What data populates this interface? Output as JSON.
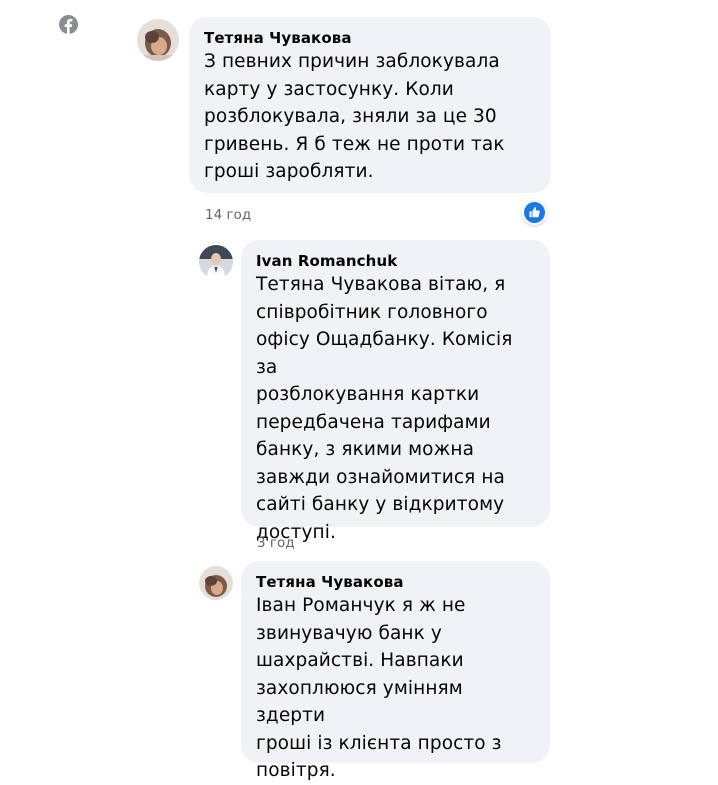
{
  "comments": [
    {
      "author": "Тетяна Чувакова",
      "text": "З певних причин заблокувала\nкарту у застосунку. Коли\nрозблокувала, зняли за це 30\nгривень. Я б теж не проти так\nгроші заробляти.",
      "time": "14 год"
    },
    {
      "author": "Ivan Romanchuk",
      "text": "Тетяна Чувакова вітаю, я\nспівробітник головного\nофісу Ощадбанку. Комісія за\nрозблокування картки\nпередбачена тарифами\nбанку, з якими можна\nзавжди ознайомитися на\nсайті банку у відкритому\nдоступі.",
      "time": "3 год"
    },
    {
      "author": "Тетяна Чувакова",
      "text": "Іван Романчук я ж не\nзвинувачую банк у\nшахрайстві. Навпаки\nзахоплююся умінням здерти\nгроші із клієнта просто з\nповітря."
    }
  ],
  "icons": {
    "site": "facebook-icon",
    "reaction": "like-icon"
  },
  "colors": {
    "bubble": "#f0f2f5",
    "like": "#1877f2",
    "timestamp": "#65676b",
    "icon_gray": "#8a8d91"
  }
}
